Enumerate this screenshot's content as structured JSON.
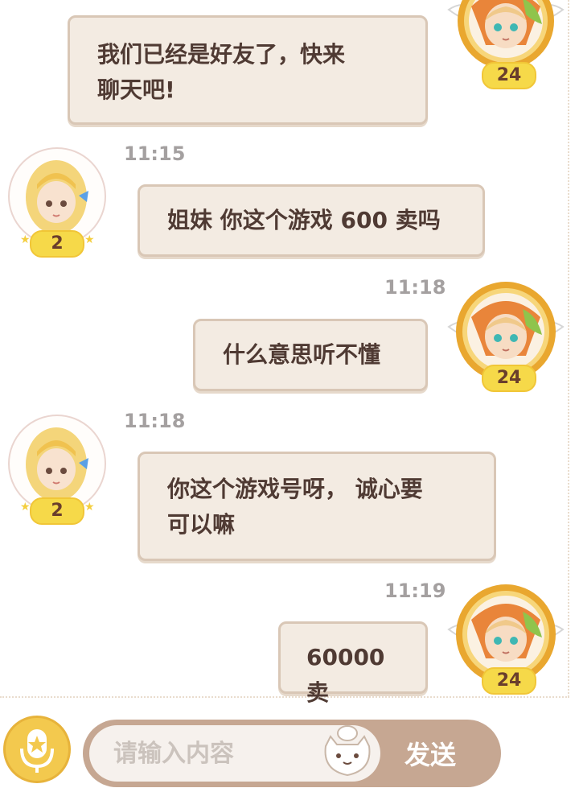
{
  "messages": [
    {
      "side": "right",
      "text": "我们已经是好友了，快来\n聊天吧!",
      "time": "",
      "level": "24"
    },
    {
      "side": "left",
      "text": "姐妹 你这个游戏 600 卖吗",
      "time": "11:15",
      "level": "2"
    },
    {
      "side": "right",
      "text": "什么意思听不懂",
      "time": "11:18",
      "level": "24"
    },
    {
      "side": "left",
      "text": "你这个游戏号呀， 诚心要\n可以嘛",
      "time": "11:18",
      "level": "2"
    },
    {
      "side": "right",
      "text": "60000卖",
      "time": "11:19",
      "level": "24"
    }
  ],
  "input": {
    "placeholder": "请输入内容",
    "value": ""
  },
  "send_button": {
    "label": "发送"
  },
  "icons": {
    "mic": "microphone-star-icon",
    "emoji": "cat-chef-emoji-icon",
    "self_avatar": "taco-hat-girl-avatar",
    "friend_avatar": "blonde-girl-avatar"
  },
  "colors": {
    "bubble_bg": "#f3ebe2",
    "bubble_border": "#d9c7b6",
    "text": "#4f3a33",
    "timestamp": "#a4a0a0",
    "send_bg": "#c6a792",
    "gold": "#e7a52b"
  }
}
